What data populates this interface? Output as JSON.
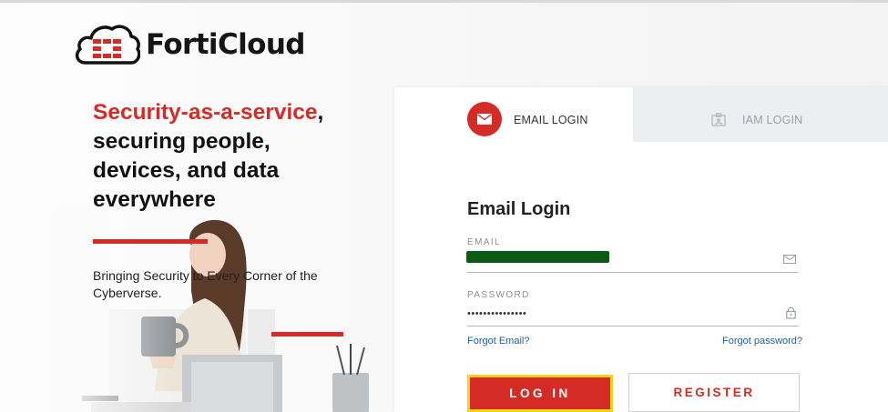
{
  "brand": {
    "name": "FortiCloud",
    "logo_icon": "forticloud-cloud-logo",
    "accent_color": "#d42b26"
  },
  "hero": {
    "tagline_accent": "Security-as-a-service",
    "tagline_comma": ",",
    "tagline_line2": "securing people,",
    "tagline_line3": "devices, and data",
    "tagline_line4": "everywhere",
    "subtext": "Bringing Security to Every Corner of the Cyberverse."
  },
  "tabs": [
    {
      "label": "EMAIL LOGIN",
      "icon": "envelope-icon",
      "active": true
    },
    {
      "label": "IAM LOGIN",
      "icon": "id-card-icon",
      "active": false
    }
  ],
  "form": {
    "title": "Email Login",
    "email_label": "EMAIL",
    "email_value": "",
    "password_label": "PASSWORD",
    "password_value": "•••••••••••••••",
    "forgot_email": "Forgot Email?",
    "forgot_password": "Forgot password?",
    "login_button": "LOG IN",
    "register_button": "REGISTER"
  }
}
